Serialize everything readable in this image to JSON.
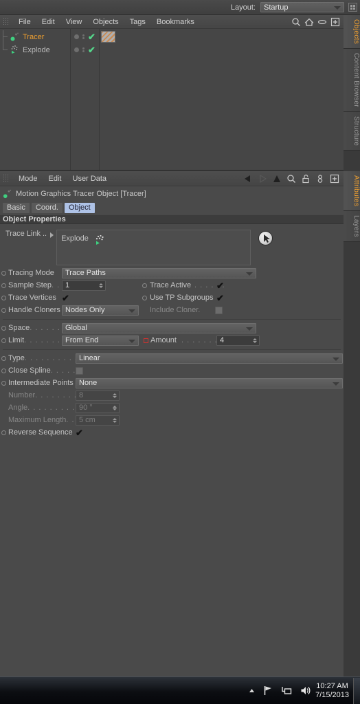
{
  "topbar": {
    "layout_label": "Layout:",
    "layout_value": "Startup",
    "grid_icon": "layout-grid-icon"
  },
  "object_manager": {
    "menu": [
      "File",
      "Edit",
      "View",
      "Objects",
      "Tags",
      "Bookmarks"
    ],
    "icons": [
      "search-icon",
      "home-icon",
      "eye-icon",
      "plus-box-icon"
    ],
    "objects": [
      {
        "name": "Tracer",
        "icon": "tracer-object-icon",
        "selected": true,
        "enabled_check": "✔",
        "has_tag": true
      },
      {
        "name": "Explode",
        "icon": "explosionfx-object-icon",
        "selected": false,
        "enabled_check": "✔",
        "has_tag": false
      }
    ]
  },
  "right_tabs_top": [
    {
      "label": "Objects",
      "active": true
    },
    {
      "label": "Content Browser",
      "active": false
    },
    {
      "label": "Structure",
      "active": false
    }
  ],
  "right_tabs_bottom": [
    {
      "label": "Attributes",
      "active": true
    },
    {
      "label": "Layers",
      "active": false
    }
  ],
  "attribute_manager": {
    "menu": [
      "Mode",
      "Edit",
      "User Data"
    ],
    "icons": [
      "back-arrow-icon",
      "forward-arrow-icon",
      "up-arrow-icon",
      "search-icon",
      "lock-icon",
      "link-icon",
      "plus-box-icon"
    ],
    "title": "Motion Graphics Tracer Object [Tracer]",
    "tabs": [
      {
        "label": "Basic",
        "active": false
      },
      {
        "label": "Coord.",
        "active": false
      },
      {
        "label": "Object",
        "active": true
      }
    ],
    "section_title": "Object Properties",
    "trace_link": {
      "label": "Trace Link",
      "label_dots": "..",
      "value": "Explode",
      "object_icon": "explosionfx-object-icon",
      "pick_button": "pick-cursor-icon"
    },
    "fields": [
      {
        "name": "tracing-mode",
        "label": "Tracing Mode",
        "dots": "",
        "type": "dropdown",
        "value": "Trace Paths",
        "disabled": false,
        "animated": false
      },
      {
        "name": "sample-step",
        "label": "Sample Step",
        "dots": " . .",
        "type": "number",
        "value": "1",
        "disabled": false,
        "animated": false
      },
      {
        "name": "trace-active",
        "label": "Trace Active",
        "dots": ". . . . . .",
        "type": "checkbox",
        "value": "✔",
        "disabled": false,
        "animated": false
      },
      {
        "name": "trace-vertices",
        "label": "Trace Vertices",
        "dots": "",
        "type": "checkbox",
        "value": "✔",
        "disabled": false,
        "animated": false
      },
      {
        "name": "use-tp-subgroups",
        "label": "Use TP Subgroups",
        "dots": "",
        "type": "checkbox",
        "value": "✔",
        "disabled": false,
        "animated": false
      },
      {
        "name": "handle-cloners",
        "label": "Handle Cloners",
        "dots": "",
        "type": "dropdown",
        "value": "Nodes Only",
        "disabled": false,
        "animated": false
      },
      {
        "name": "include-cloner",
        "label": "Include Cloner",
        "dots": ". . .",
        "type": "checkbox",
        "value": "",
        "disabled": true,
        "animated": false
      },
      {
        "name": "space",
        "label": "Space",
        "dots": ". . . . . . . .",
        "type": "dropdown",
        "value": "Global",
        "disabled": false,
        "animated": false
      },
      {
        "name": "limit",
        "label": "Limit",
        "dots": ". . . . . . . .",
        "type": "dropdown",
        "value": "From End",
        "disabled": false,
        "animated": false
      },
      {
        "name": "amount",
        "label": "Amount",
        "dots": ". . . . . . . . .",
        "type": "number",
        "value": "4",
        "disabled": false,
        "animated": true
      },
      {
        "name": "type",
        "label": "Type",
        "dots": ". . . . . . . . . . . .",
        "type": "dropdown",
        "value": "Linear",
        "disabled": false,
        "animated": false
      },
      {
        "name": "close-spline",
        "label": "Close Spline",
        "dots": ". . . . . .",
        "type": "checkbox",
        "value": "",
        "disabled": false,
        "animated": false
      },
      {
        "name": "intermediate-points",
        "label": "Intermediate Points",
        "dots": "",
        "type": "dropdown",
        "value": "None",
        "disabled": false,
        "animated": false
      },
      {
        "name": "number",
        "label": "Number",
        "dots": ". . . . . . . . .",
        "type": "number",
        "value": "8",
        "disabled": true,
        "animated": false
      },
      {
        "name": "angle",
        "label": "Angle",
        "dots": ". . . . . . . . . . .",
        "type": "number",
        "value": "90 °",
        "disabled": true,
        "animated": false
      },
      {
        "name": "maximum-length",
        "label": "Maximum Length",
        "dots": " . .",
        "type": "number",
        "value": "5 cm",
        "disabled": true,
        "animated": false
      },
      {
        "name": "reverse-sequence",
        "label": "Reverse Sequence",
        "dots": "",
        "type": "checkbox",
        "value": "✔",
        "disabled": false,
        "animated": false
      }
    ]
  },
  "taskbar": {
    "show_hidden_icon": "chevron-up-icon",
    "tray_icons": [
      "flag-icon",
      "network-icon",
      "volume-icon"
    ],
    "time": "10:27 AM",
    "date": "7/15/2013"
  },
  "colors": {
    "accent_orange": "#f0a030",
    "tab_active_blue": "#aec2e6",
    "check_green": "#55d68a",
    "animated_red": "#d0332f",
    "panel_bg": "#4a4a4a"
  }
}
